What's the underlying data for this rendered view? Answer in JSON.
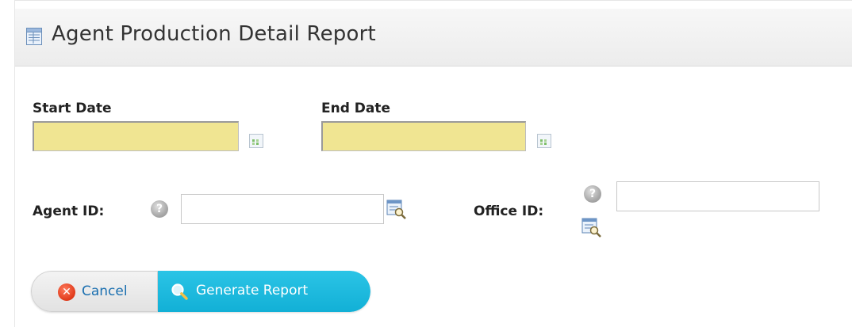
{
  "header": {
    "title": "Agent Production Detail Report",
    "icon": "report-icon"
  },
  "form": {
    "start_date": {
      "label": "Start Date",
      "value": "",
      "icon": "calendar-icon"
    },
    "end_date": {
      "label": "End Date",
      "value": "",
      "icon": "calendar-icon"
    },
    "agent_id": {
      "label": "Agent ID:",
      "value": "",
      "help_glyph": "?",
      "lookup_icon": "lookup-icon"
    },
    "office_id": {
      "label": "Office ID:",
      "value": "",
      "help_glyph": "?",
      "lookup_icon": "lookup-icon"
    }
  },
  "buttons": {
    "cancel": {
      "label": "Cancel",
      "icon": "cancel-x-icon"
    },
    "generate": {
      "label": "Generate Report",
      "icon": "magnifier-icon"
    }
  },
  "colors": {
    "date_field_bg": "#f0e592",
    "generate_button": "#19b6da",
    "cancel_icon": "#e03a1a",
    "cancel_label": "#1a6fb0"
  }
}
